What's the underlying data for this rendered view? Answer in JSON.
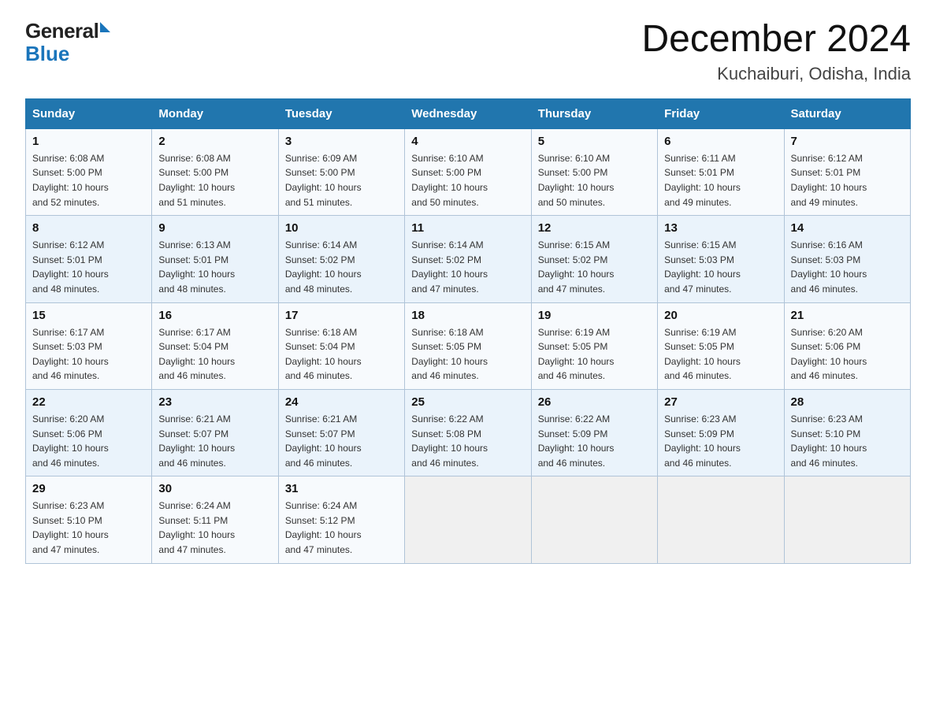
{
  "logo": {
    "general": "General",
    "arrow_color": "#1a75bb",
    "blue": "Blue"
  },
  "header": {
    "month_year": "December 2024",
    "location": "Kuchaiburi, Odisha, India"
  },
  "weekdays": [
    "Sunday",
    "Monday",
    "Tuesday",
    "Wednesday",
    "Thursday",
    "Friday",
    "Saturday"
  ],
  "weeks": [
    [
      {
        "day": "1",
        "sunrise": "6:08 AM",
        "sunset": "5:00 PM",
        "daylight": "10 hours and 52 minutes."
      },
      {
        "day": "2",
        "sunrise": "6:08 AM",
        "sunset": "5:00 PM",
        "daylight": "10 hours and 51 minutes."
      },
      {
        "day": "3",
        "sunrise": "6:09 AM",
        "sunset": "5:00 PM",
        "daylight": "10 hours and 51 minutes."
      },
      {
        "day": "4",
        "sunrise": "6:10 AM",
        "sunset": "5:00 PM",
        "daylight": "10 hours and 50 minutes."
      },
      {
        "day": "5",
        "sunrise": "6:10 AM",
        "sunset": "5:00 PM",
        "daylight": "10 hours and 50 minutes."
      },
      {
        "day": "6",
        "sunrise": "6:11 AM",
        "sunset": "5:01 PM",
        "daylight": "10 hours and 49 minutes."
      },
      {
        "day": "7",
        "sunrise": "6:12 AM",
        "sunset": "5:01 PM",
        "daylight": "10 hours and 49 minutes."
      }
    ],
    [
      {
        "day": "8",
        "sunrise": "6:12 AM",
        "sunset": "5:01 PM",
        "daylight": "10 hours and 48 minutes."
      },
      {
        "day": "9",
        "sunrise": "6:13 AM",
        "sunset": "5:01 PM",
        "daylight": "10 hours and 48 minutes."
      },
      {
        "day": "10",
        "sunrise": "6:14 AM",
        "sunset": "5:02 PM",
        "daylight": "10 hours and 48 minutes."
      },
      {
        "day": "11",
        "sunrise": "6:14 AM",
        "sunset": "5:02 PM",
        "daylight": "10 hours and 47 minutes."
      },
      {
        "day": "12",
        "sunrise": "6:15 AM",
        "sunset": "5:02 PM",
        "daylight": "10 hours and 47 minutes."
      },
      {
        "day": "13",
        "sunrise": "6:15 AM",
        "sunset": "5:03 PM",
        "daylight": "10 hours and 47 minutes."
      },
      {
        "day": "14",
        "sunrise": "6:16 AM",
        "sunset": "5:03 PM",
        "daylight": "10 hours and 46 minutes."
      }
    ],
    [
      {
        "day": "15",
        "sunrise": "6:17 AM",
        "sunset": "5:03 PM",
        "daylight": "10 hours and 46 minutes."
      },
      {
        "day": "16",
        "sunrise": "6:17 AM",
        "sunset": "5:04 PM",
        "daylight": "10 hours and 46 minutes."
      },
      {
        "day": "17",
        "sunrise": "6:18 AM",
        "sunset": "5:04 PM",
        "daylight": "10 hours and 46 minutes."
      },
      {
        "day": "18",
        "sunrise": "6:18 AM",
        "sunset": "5:05 PM",
        "daylight": "10 hours and 46 minutes."
      },
      {
        "day": "19",
        "sunrise": "6:19 AM",
        "sunset": "5:05 PM",
        "daylight": "10 hours and 46 minutes."
      },
      {
        "day": "20",
        "sunrise": "6:19 AM",
        "sunset": "5:05 PM",
        "daylight": "10 hours and 46 minutes."
      },
      {
        "day": "21",
        "sunrise": "6:20 AM",
        "sunset": "5:06 PM",
        "daylight": "10 hours and 46 minutes."
      }
    ],
    [
      {
        "day": "22",
        "sunrise": "6:20 AM",
        "sunset": "5:06 PM",
        "daylight": "10 hours and 46 minutes."
      },
      {
        "day": "23",
        "sunrise": "6:21 AM",
        "sunset": "5:07 PM",
        "daylight": "10 hours and 46 minutes."
      },
      {
        "day": "24",
        "sunrise": "6:21 AM",
        "sunset": "5:07 PM",
        "daylight": "10 hours and 46 minutes."
      },
      {
        "day": "25",
        "sunrise": "6:22 AM",
        "sunset": "5:08 PM",
        "daylight": "10 hours and 46 minutes."
      },
      {
        "day": "26",
        "sunrise": "6:22 AM",
        "sunset": "5:09 PM",
        "daylight": "10 hours and 46 minutes."
      },
      {
        "day": "27",
        "sunrise": "6:23 AM",
        "sunset": "5:09 PM",
        "daylight": "10 hours and 46 minutes."
      },
      {
        "day": "28",
        "sunrise": "6:23 AM",
        "sunset": "5:10 PM",
        "daylight": "10 hours and 46 minutes."
      }
    ],
    [
      {
        "day": "29",
        "sunrise": "6:23 AM",
        "sunset": "5:10 PM",
        "daylight": "10 hours and 47 minutes."
      },
      {
        "day": "30",
        "sunrise": "6:24 AM",
        "sunset": "5:11 PM",
        "daylight": "10 hours and 47 minutes."
      },
      {
        "day": "31",
        "sunrise": "6:24 AM",
        "sunset": "5:12 PM",
        "daylight": "10 hours and 47 minutes."
      },
      null,
      null,
      null,
      null
    ]
  ],
  "labels": {
    "sunrise": "Sunrise:",
    "sunset": "Sunset:",
    "daylight": "Daylight:"
  }
}
